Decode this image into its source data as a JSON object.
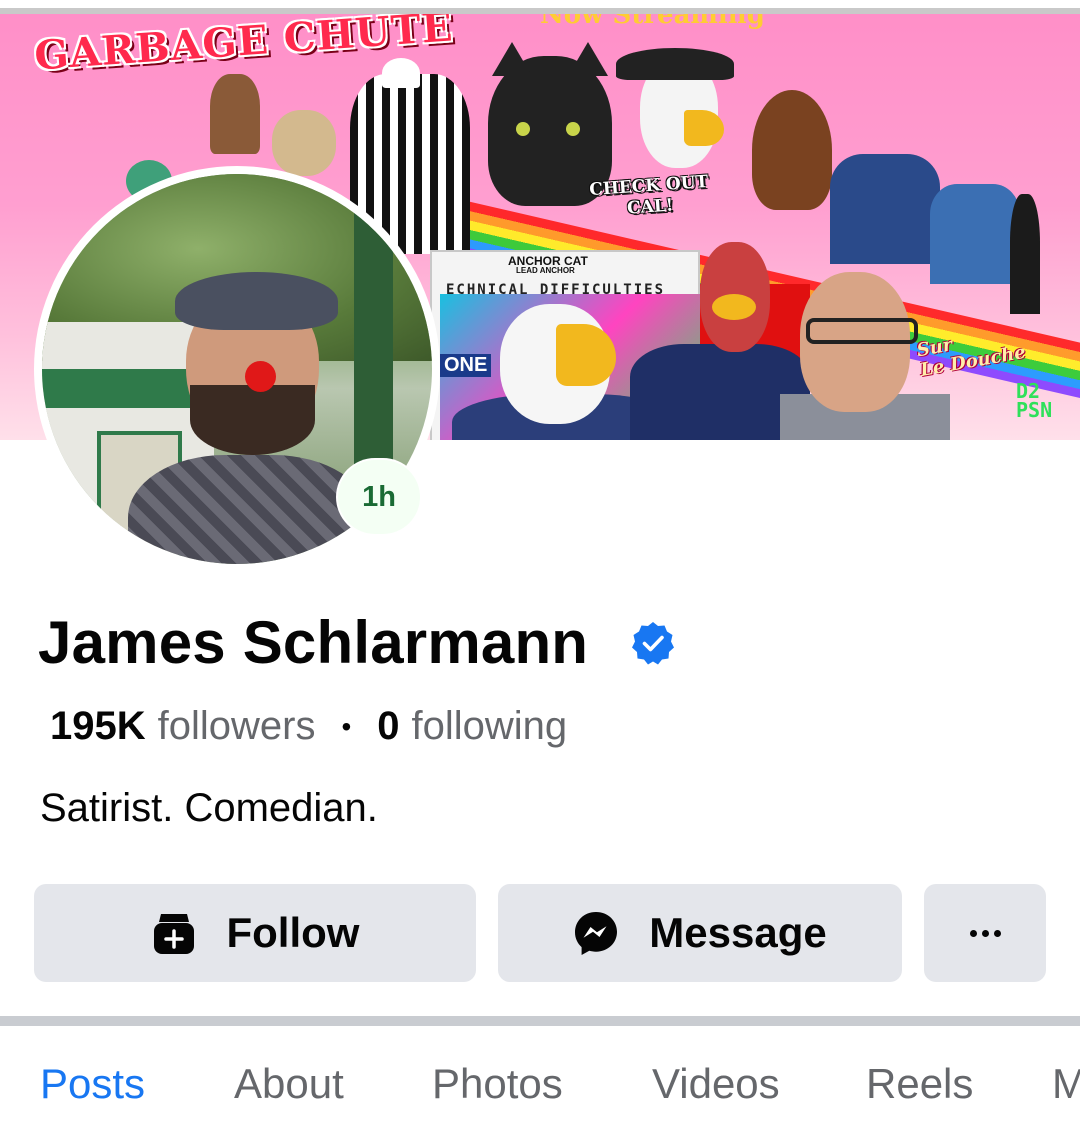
{
  "cover": {
    "logo_text": "GARBAGE CHUTE",
    "top_text": "Now Streaming",
    "check_out_text_1": "CHECK OUT",
    "check_out_text_2": "CAL!",
    "anchor_label": "ANCHOR CAT",
    "anchor_sublabel": "LEAD ANCHOR",
    "ticker_text": "ECHNICAL DIFFICULTIES",
    "one_text": "ONE",
    "sur_text_1": "Sur",
    "sur_text_2": "Le Douche",
    "network_text_1": "D2",
    "network_text_2": "PSN"
  },
  "avatar": {
    "story_badge": "1h"
  },
  "profile": {
    "name": "James Schlarmann",
    "verified": true,
    "followers_count": "195K",
    "followers_label": "followers",
    "separator": "•",
    "following_count": "0",
    "following_label": "following",
    "bio": "Satirist. Comedian."
  },
  "actions": {
    "follow_label": "Follow",
    "message_label": "Message",
    "more_icon": "more-dots-icon"
  },
  "tabs": [
    {
      "label": "Posts",
      "active": true
    },
    {
      "label": "About",
      "active": false
    },
    {
      "label": "Photos",
      "active": false
    },
    {
      "label": "Videos",
      "active": false
    },
    {
      "label": "Reels",
      "active": false
    },
    {
      "label": "M",
      "active": false
    }
  ],
  "colors": {
    "accent": "#1877f2",
    "button_bg": "#e4e6eb",
    "secondary_text": "#65676b",
    "story_badge_text": "#1a6b34"
  }
}
